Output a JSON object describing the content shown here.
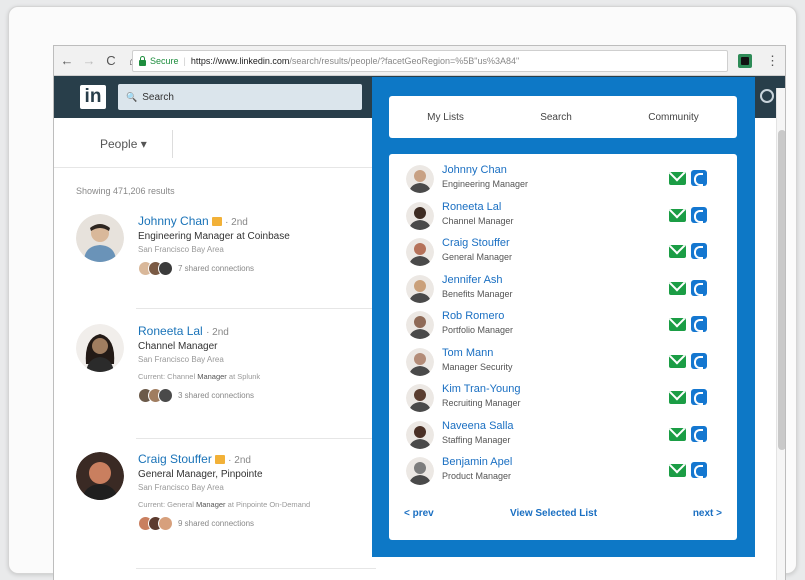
{
  "browser": {
    "back_glyph": "←",
    "forward_glyph": "→",
    "reload_glyph": "C",
    "home_glyph": "⌂",
    "secure_label": "Secure",
    "url_host": "https://www.linkedin.com",
    "url_path": "/search/results/people/?facetGeoRegion=%5B\"us%3A84\"",
    "menu_glyph": "⋮"
  },
  "linkedin": {
    "logo_text": "in",
    "search_icon": "🔍",
    "search_placeholder": "Search",
    "people_filter": "People ▾",
    "result_count": "Showing 471,206 results"
  },
  "results": [
    {
      "name": "Johnny Chan",
      "degree": "· 2nd",
      "title": "Engineering Manager at Coinbase",
      "location": "San Francisco Bay Area",
      "current": "",
      "shared": "7 shared connections",
      "colors": [
        "#d9b89a",
        "#7a5a44",
        "#3b3b3b"
      ]
    },
    {
      "name": "Roneeta Lal",
      "degree": "· 2nd",
      "title": "Channel Manager",
      "location": "San Francisco Bay Area",
      "current_prefix": "Current: Channel ",
      "current_bold": "Manager",
      "current_suffix": " at Splunk",
      "shared": "3 shared connections",
      "colors": [
        "#6b5a4a",
        "#a07d60",
        "#4a4a4a"
      ]
    },
    {
      "name": "Craig Stouffer",
      "degree": "· 2nd",
      "title": "General Manager, Pinpointe",
      "location": "San Francisco Bay Area",
      "current_prefix": "Current: General ",
      "current_bold": "Manager",
      "current_suffix": " at Pinpointe On-Demand",
      "shared": "9 shared connections",
      "colors": [
        "#c97f5f",
        "#5c3a2e",
        "#d7a07c"
      ]
    }
  ],
  "panel": {
    "tabs": [
      "My Lists",
      "Search",
      "Community"
    ],
    "contacts": [
      {
        "name": "Johnny Chan",
        "role": "Engineering Manager",
        "color": "#c8a184"
      },
      {
        "name": "Roneeta Lal",
        "role": "Channel Manager",
        "color": "#3d2b22"
      },
      {
        "name": "Craig Stouffer",
        "role": "General Manager",
        "color": "#b5725a"
      },
      {
        "name": "Jennifer Ash",
        "role": "Benefits Manager",
        "color": "#caa07a"
      },
      {
        "name": "Rob Romero",
        "role": "Portfolio Manager",
        "color": "#8f6a57"
      },
      {
        "name": "Tom Mann",
        "role": "Manager Security",
        "color": "#b38c78"
      },
      {
        "name": "Kim Tran-Young",
        "role": "Recruiting Manager",
        "color": "#5a3d2f"
      },
      {
        "name": "Naveena Salla",
        "role": "Staffing Manager",
        "color": "#4a3026"
      },
      {
        "name": "Benjamin Apel",
        "role": "Product Manager",
        "color": "#7d7d7d"
      }
    ],
    "prev_label": "< prev",
    "view_label": "View Selected List",
    "next_label": "next >"
  }
}
